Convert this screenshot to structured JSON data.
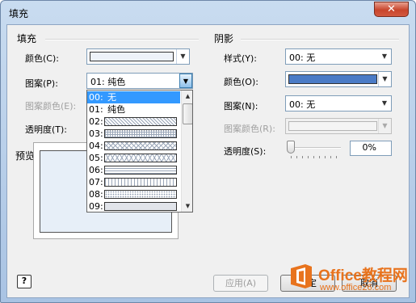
{
  "window": {
    "title": "填充",
    "close_glyph": "✕"
  },
  "fill": {
    "section_title": "填充",
    "color_label": "颜色(C):",
    "color_swatch": "#eef2f9",
    "pattern_label": "图案(P):",
    "pattern_value": "01: 纯色",
    "pattern_color_label": "图案颜色(E):",
    "transparency_label": "透明度(T):"
  },
  "dropdown": {
    "items": [
      {
        "code": "00:",
        "text": "无",
        "pattern": "none"
      },
      {
        "code": "01:",
        "text": "纯色",
        "pattern": "none"
      },
      {
        "code": "02:",
        "text": "",
        "pattern": "diag-dense"
      },
      {
        "code": "03:",
        "text": "",
        "pattern": "grid-fine"
      },
      {
        "code": "04:",
        "text": "",
        "pattern": "diag-cross"
      },
      {
        "code": "05:",
        "text": "",
        "pattern": "diamond"
      },
      {
        "code": "06:",
        "text": "",
        "pattern": "horizontal"
      },
      {
        "code": "07:",
        "text": "",
        "pattern": "vertical"
      },
      {
        "code": "08:",
        "text": "",
        "pattern": "dots"
      },
      {
        "code": "09:",
        "text": "",
        "pattern": "dots-fine"
      }
    ],
    "selected_index": 0
  },
  "preview": {
    "label": "预览",
    "fill_color": "#e7eff8"
  },
  "shadow": {
    "section_title": "阴影",
    "style_label": "样式(Y):",
    "style_value": "00: 无",
    "color_label": "颜色(O):",
    "color_swatch": "#4a7bc6",
    "pattern_label": "图案(N):",
    "pattern_value": "00: 无",
    "pattern_color_label": "图案颜色(R):",
    "transparency_label": "透明度(S):",
    "transparency_value": "0%"
  },
  "buttons": {
    "help": "?",
    "apply": "应用(A)",
    "ok": "确定",
    "cancel": "取消"
  },
  "watermark": {
    "title": "Office教程网",
    "site": "www.office26.com",
    "brand_color": "#e8731d"
  }
}
